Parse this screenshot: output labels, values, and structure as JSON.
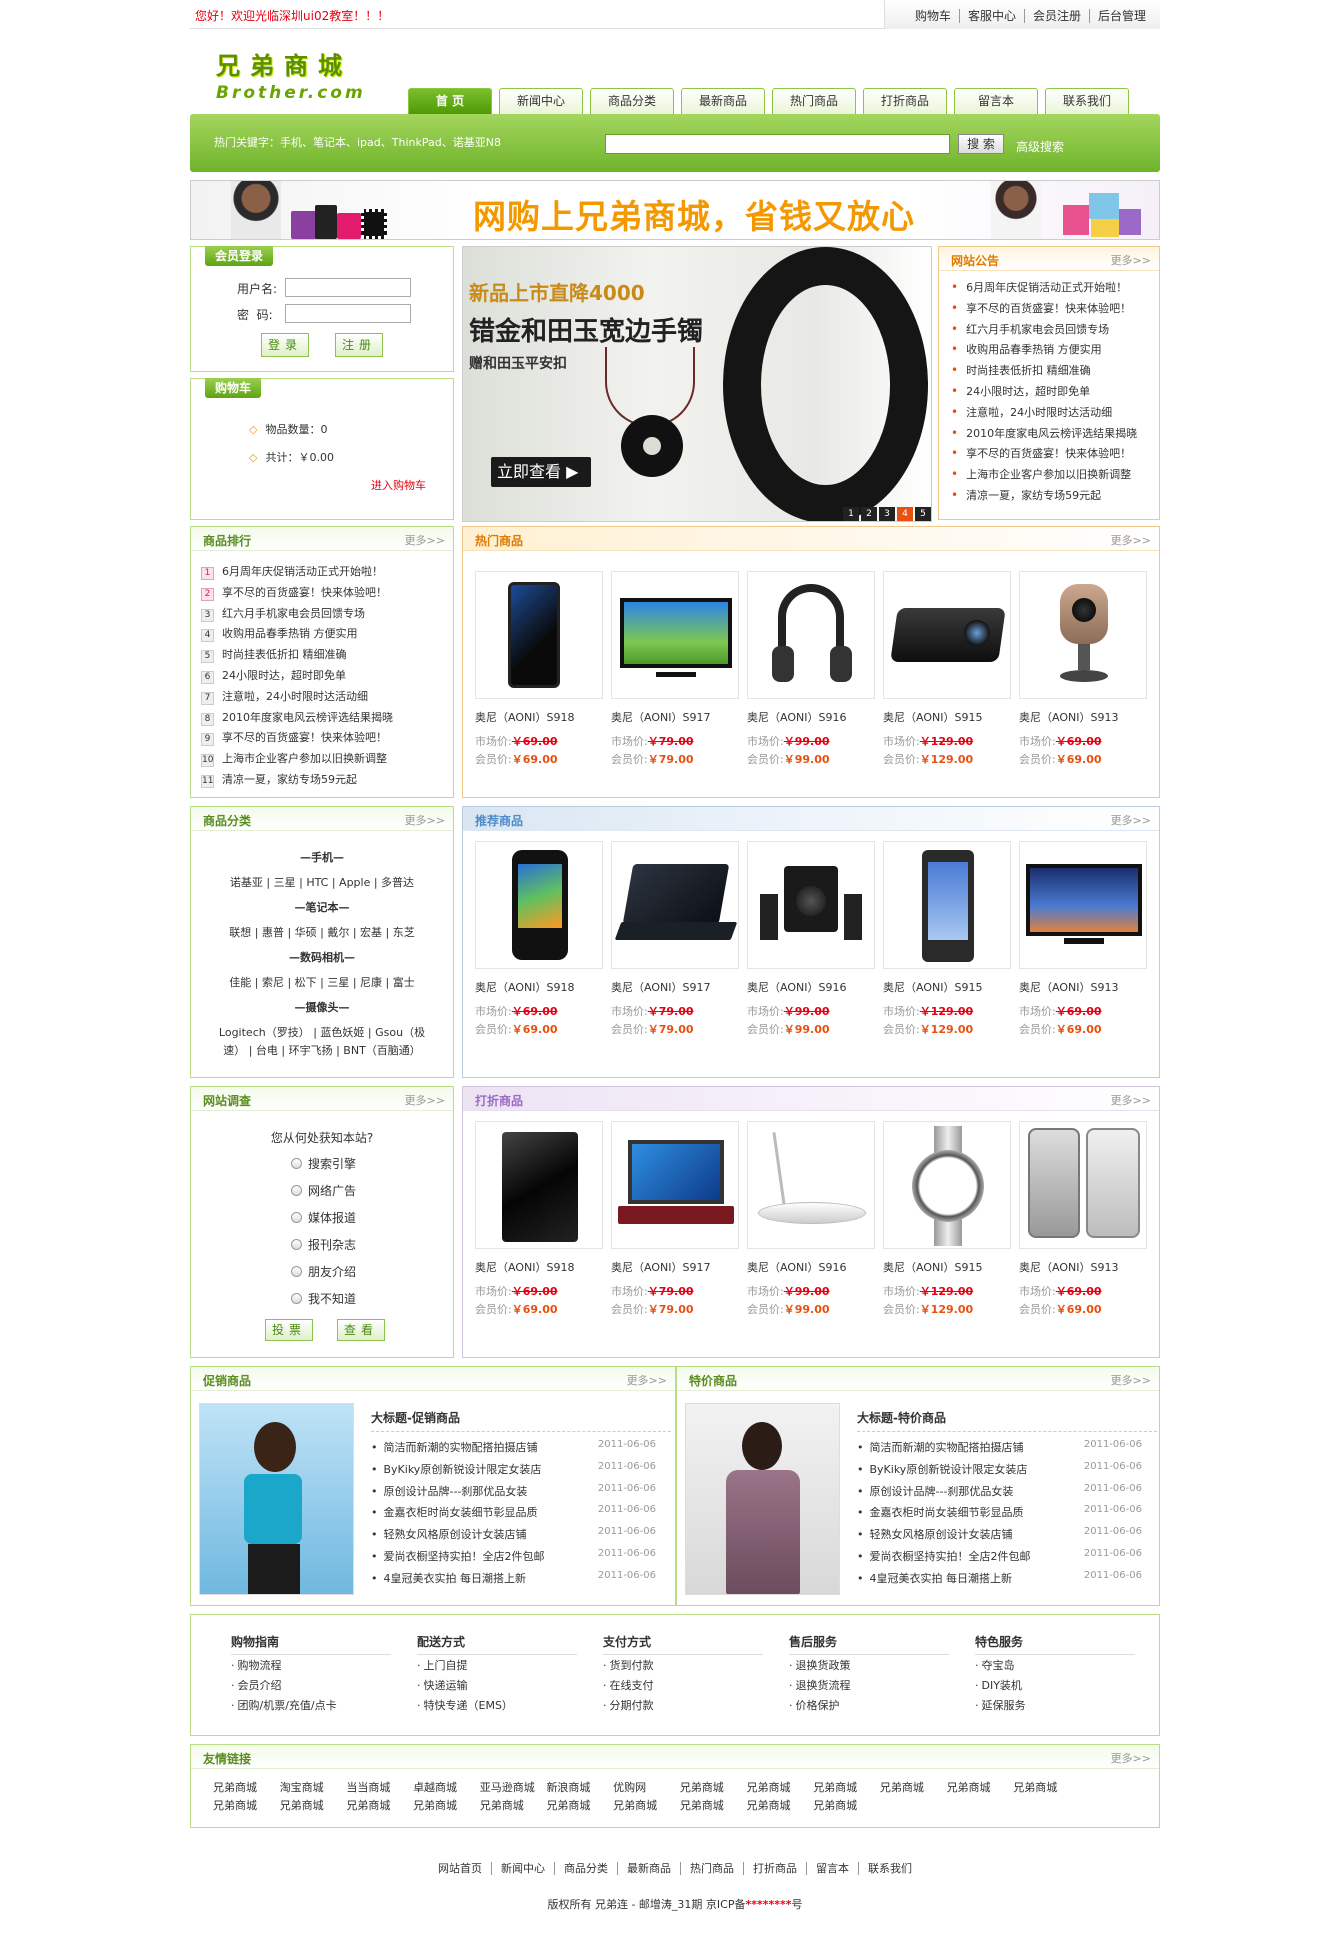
{
  "topbar": {
    "welcome": "您好！欢迎光临深圳ui02教室！！！",
    "links": [
      "购物车",
      "客服中心",
      "会员注册",
      "后台管理"
    ]
  },
  "logo": {
    "cn": "兄弟商城",
    "en": "Brother.com"
  },
  "nav": [
    "首 页",
    "新闻中心",
    "商品分类",
    "最新商品",
    "热门商品",
    "打折商品",
    "留言本",
    "联系我们"
  ],
  "search": {
    "hot_keywords": "热门关键字：手机、笔记本、ipad、ThinkPad、诺基亚N8",
    "button": "搜 索",
    "advanced": "高级搜索"
  },
  "banner": {
    "slogan": "网购上兄弟商城，省钱又放心"
  },
  "login": {
    "tag": "会员登录",
    "username_label": "用户名:",
    "password_label": "密  码:",
    "login_btn": "登录",
    "register_btn": "注册"
  },
  "cart": {
    "tag": "购物车",
    "count": "物品数量：0",
    "total": "共计：￥0.00",
    "enter": "进入购物车"
  },
  "slider": {
    "line1": "新品上市直降4000",
    "line2": "错金和田玉宽边手镯",
    "line3": "赠和田玉平安扣",
    "cta": "立即查看",
    "pages": [
      "1",
      "2",
      "3",
      "4",
      "5"
    ],
    "active_page": "4"
  },
  "notice": {
    "title": "网站公告",
    "more": "更多>>",
    "items": [
      "6月周年庆促销活动正式开始啦！",
      "享不尽的百货盛宴！快来体验吧！",
      "红六月手机家电会员回馈专场",
      "收购用品春季热销 方便实用",
      "时尚挂表低折扣 精细准确",
      "24小限时达，超时即免单",
      "注意啦，24小时限时达活动细",
      "2010年度家电风云榜评选结果揭晓",
      "享不尽的百货盛宴！快来体验吧！",
      "上海市企业客户参加以旧换新调整",
      "清凉一夏，家纺专场59元起"
    ]
  },
  "rank": {
    "title": "商品排行",
    "more": "更多>>",
    "items": [
      "6月周年庆促销活动正式开始啦！",
      "享不尽的百货盛宴！快来体验吧！",
      "红六月手机家电会员回馈专场",
      "收购用品春季热销 方便实用",
      "时尚挂表低折扣 精细准确",
      "24小限时达，超时即免单",
      "注意啦，24小时限时达活动细",
      "2010年度家电风云榜评选结果揭晓",
      "享不尽的百货盛宴！快来体验吧！",
      "上海市企业客户参加以旧换新调整",
      "清凉一夏，家纺专场59元起"
    ]
  },
  "category": {
    "title": "商品分类",
    "more": "更多>>",
    "groups": [
      {
        "head": "—手机—",
        "items": "诺基亚 | 三星 | HTC | Apple | 多普达"
      },
      {
        "head": "—笔记本—",
        "items": "联想 | 惠普 | 华硕 | 戴尔 | 宏基 | 东芝"
      },
      {
        "head": "—数码相机—",
        "items": "佳能 | 索尼 | 松下 | 三星 | 尼康 | 富士"
      },
      {
        "head": "—摄像头—",
        "items": "Logitech（罗技） | 蓝色妖姬 | Gsou（极",
        "items2": "速） | 台电 | 环宇飞扬 | BNT（百脑通）"
      }
    ]
  },
  "hot": {
    "title": "热门商品",
    "more": "更多>>",
    "products": [
      {
        "name": "奥尼（AONI）S918",
        "market_label": "市场价:",
        "market": "￥69.00",
        "member_label": "会员价:",
        "member": "￥69.00"
      },
      {
        "name": "奥尼（AONI）S917",
        "market_label": "市场价:",
        "market": "￥79.00",
        "member_label": "会员价:",
        "member": "￥79.00"
      },
      {
        "name": "奥尼（AONI）S916",
        "market_label": "市场价:",
        "market": "￥99.00",
        "member_label": "会员价:",
        "member": "￥99.00"
      },
      {
        "name": "奥尼（AONI）S915",
        "market_label": "市场价:",
        "market": "￥129.00",
        "member_label": "会员价:",
        "member": "￥129.00"
      },
      {
        "name": "奥尼（AONI）S913",
        "market_label": "市场价:",
        "market": "￥69.00",
        "member_label": "会员价:",
        "member": "￥69.00"
      }
    ]
  },
  "recommend": {
    "title": "推荐商品",
    "more": "更多>>",
    "products": [
      {
        "name": "奥尼（AONI）S918",
        "market_label": "市场价:",
        "market": "￥69.00",
        "member_label": "会员价:",
        "member": "￥69.00"
      },
      {
        "name": "奥尼（AONI）S917",
        "market_label": "市场价:",
        "market": "￥79.00",
        "member_label": "会员价:",
        "member": "￥79.00"
      },
      {
        "name": "奥尼（AONI）S916",
        "market_label": "市场价:",
        "market": "￥99.00",
        "member_label": "会员价:",
        "member": "￥99.00"
      },
      {
        "name": "奥尼（AONI）S915",
        "market_label": "市场价:",
        "market": "￥129.00",
        "member_label": "会员价:",
        "member": "￥129.00"
      },
      {
        "name": "奥尼（AONI）S913",
        "market_label": "市场价:",
        "market": "￥69.00",
        "member_label": "会员价:",
        "member": "￥69.00"
      }
    ]
  },
  "discount": {
    "title": "打折商品",
    "more": "更多>>",
    "products": [
      {
        "name": "奥尼（AONI）S918",
        "market_label": "市场价:",
        "market": "￥69.00",
        "member_label": "会员价:",
        "member": "￥69.00"
      },
      {
        "name": "奥尼（AONI）S917",
        "market_label": "市场价:",
        "market": "￥79.00",
        "member_label": "会员价:",
        "member": "￥79.00"
      },
      {
        "name": "奥尼（AONI）S916",
        "market_label": "市场价:",
        "market": "￥99.00",
        "member_label": "会员价:",
        "member": "￥99.00"
      },
      {
        "name": "奥尼（AONI）S915",
        "market_label": "市场价:",
        "market": "￥129.00",
        "member_label": "会员价:",
        "member": "￥129.00"
      },
      {
        "name": "奥尼（AONI）S913",
        "market_label": "市场价:",
        "market": "￥69.00",
        "member_label": "会员价:",
        "member": "￥69.00"
      }
    ]
  },
  "survey": {
    "title": "网站调查",
    "more": "更多>>",
    "question": "您从何处获知本站?",
    "options": [
      "搜索引擎",
      "网络广告",
      "媒体报道",
      "报刊杂志",
      "朋友介绍",
      "我不知道"
    ],
    "vote": "投票",
    "view": "查看"
  },
  "promo": {
    "title": "促销商品",
    "more": "更多>>",
    "headline": "大标题-促销商品",
    "items": [
      {
        "t": "简洁而新潮的实物配搭拍摄店铺",
        "d": "2011-06-06"
      },
      {
        "t": "ByKiky原创新锐设计限定女装店",
        "d": "2011-06-06"
      },
      {
        "t": "原创设计品牌---刹那优品女装",
        "d": "2011-06-06"
      },
      {
        "t": "金嘉衣柜时尚女装细节彰显品质",
        "d": "2011-06-06"
      },
      {
        "t": "轻熟女风格原创设计女装店铺",
        "d": "2011-06-06"
      },
      {
        "t": "爱尚衣橱坚持实拍！全店2件包邮",
        "d": "2011-06-06"
      },
      {
        "t": "4皇冠美衣实拍 每日潮搭上新",
        "d": "2011-06-06"
      }
    ]
  },
  "special": {
    "title": "特价商品",
    "more": "更多>>",
    "headline": "大标题-特价商品",
    "items": [
      {
        "t": "简洁而新潮的实物配搭拍摄店铺",
        "d": "2011-06-06"
      },
      {
        "t": "ByKiky原创新锐设计限定女装店",
        "d": "2011-06-06"
      },
      {
        "t": "原创设计品牌---刹那优品女装",
        "d": "2011-06-06"
      },
      {
        "t": "金嘉衣柜时尚女装细节彰显品质",
        "d": "2011-06-06"
      },
      {
        "t": "轻熟女风格原创设计女装店铺",
        "d": "2011-06-06"
      },
      {
        "t": "爱尚衣橱坚持实拍！全店2件包邮",
        "d": "2011-06-06"
      },
      {
        "t": "4皇冠美衣实拍 每日潮搭上新",
        "d": "2011-06-06"
      }
    ]
  },
  "help": [
    {
      "head": "购物指南",
      "items": [
        "购物流程",
        "会员介绍",
        "团购/机票/充值/点卡"
      ]
    },
    {
      "head": "配送方式",
      "items": [
        "上门自提",
        "快递运输",
        "特快专递（EMS）"
      ]
    },
    {
      "head": "支付方式",
      "items": [
        "货到付款",
        "在线支付",
        "分期付款"
      ]
    },
    {
      "head": "售后服务",
      "items": [
        "退换货政策",
        "退换货流程",
        "价格保护"
      ]
    },
    {
      "head": "特色服务",
      "items": [
        "夺宝岛",
        "DIY装机",
        "延保服务"
      ]
    }
  ],
  "friends": {
    "title": "友情链接",
    "more": "更多>>",
    "links": [
      "兄弟商城",
      "淘宝商城",
      "当当商城",
      "卓越商城",
      "亚马逊商城",
      "新浪商城",
      "优购网",
      "兄弟商城",
      "兄弟商城",
      "兄弟商城",
      "兄弟商城",
      "兄弟商城",
      "兄弟商城",
      "兄弟商城",
      "兄弟商城",
      "兄弟商城",
      "兄弟商城",
      "兄弟商城",
      "兄弟商城",
      "兄弟商城",
      "兄弟商城",
      "兄弟商城",
      "兄弟商城"
    ]
  },
  "bottom_nav": [
    "网站首页",
    "新闻中心",
    "商品分类",
    "最新商品",
    "热门商品",
    "打折商品",
    "留言本",
    "联系我们"
  ],
  "copyright": {
    "text": "版权所有 兄弟连 - 邮增涛_31期 京ICP备",
    "mask": "********",
    "tail": "号"
  },
  "colors": {
    "brand_green": "#6fb32a",
    "price_red": "#e60012",
    "accent_orange": "#f39800"
  }
}
